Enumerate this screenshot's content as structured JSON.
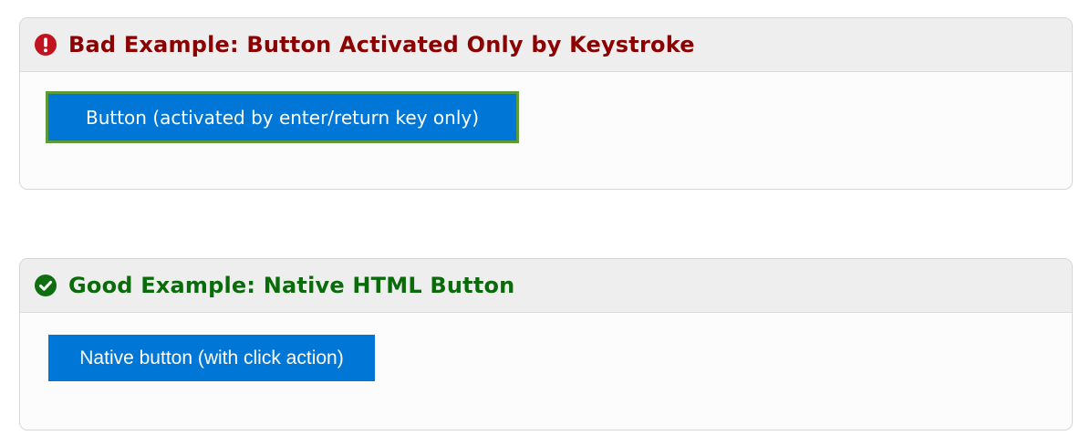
{
  "bad_example": {
    "icon": "exclamation-circle-icon",
    "title": "Bad Example: Button Activated Only by Keystroke",
    "button_label": "Button (activated by enter/return key only)",
    "accent_color": "#8b0000",
    "icon_color": "#c1121f"
  },
  "good_example": {
    "icon": "checkmark-circle-icon",
    "title": "Good Example: Native HTML Button",
    "button_label": "Native button (with click action)",
    "accent_color": "#0a6b0a",
    "icon_color": "#0e6e10"
  },
  "colors": {
    "button_bg": "#0077d6",
    "focus_outline": "#5c9a3a"
  }
}
